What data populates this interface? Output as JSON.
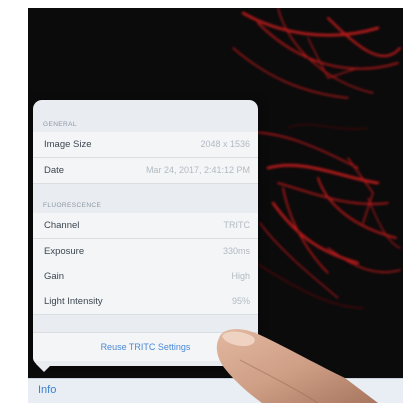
{
  "popover": {
    "sections": {
      "general": "GENERAL",
      "fluorescence": "FLUORESCENCE"
    },
    "general_rows": [
      {
        "label": "Image Size",
        "value": "2048 x 1536"
      },
      {
        "label": "Date",
        "value": "Mar 24, 2017, 2:41:12 PM"
      }
    ],
    "fluorescence_rows": [
      {
        "label": "Channel",
        "value": "TRITC"
      },
      {
        "label": "Exposure",
        "value": "330ms"
      },
      {
        "label": "Gain",
        "value": "High"
      },
      {
        "label": "Light Intensity",
        "value": "95%"
      }
    ],
    "action_label": "Reuse TRITC Settings"
  },
  "tabbar": {
    "info_label": "Info"
  },
  "colors": {
    "accent": "#4a89d6",
    "fluorescence_red": "#d01b1b",
    "screen_bg": "#0b0b0c"
  }
}
